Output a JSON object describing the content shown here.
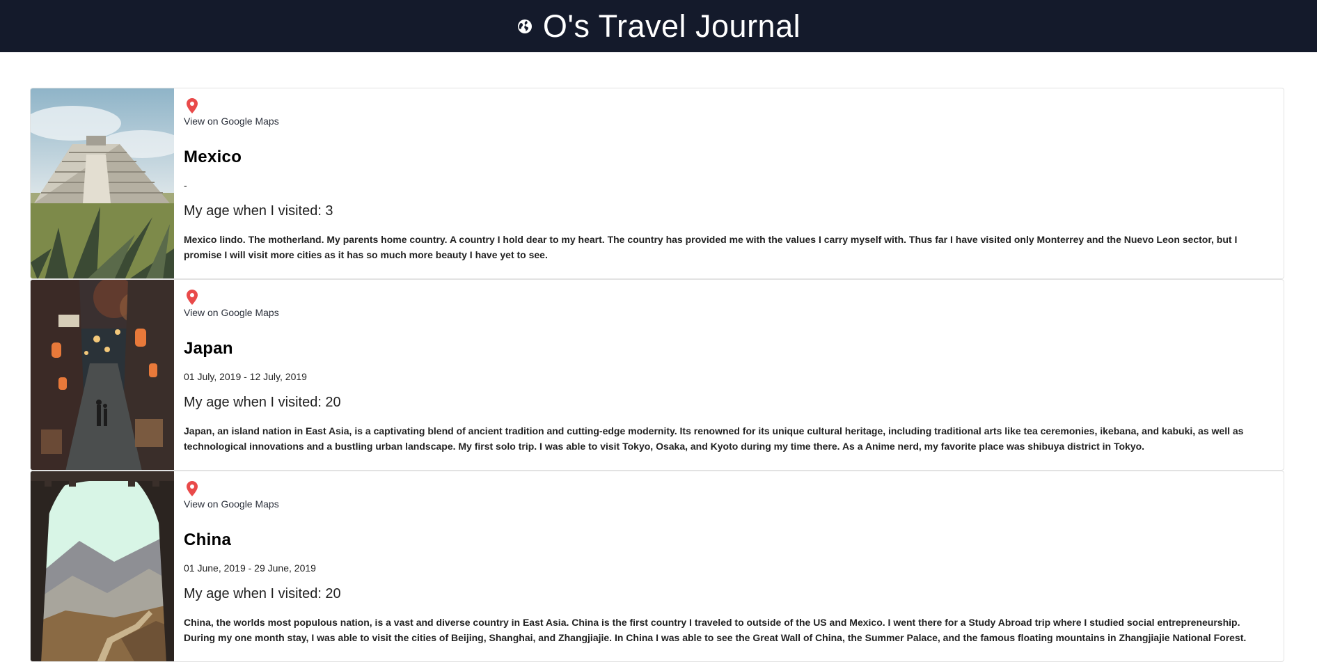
{
  "header": {
    "title": "O's Travel Journal",
    "icon": "globe-icon",
    "background": "#141a2b"
  },
  "entries": [
    {
      "image": "pyramid-photo",
      "pin_icon": "location-pin-icon",
      "maps_label": "View on Google Maps",
      "country": "Mexico",
      "dates": "-",
      "age": "My age when I visited: 3",
      "description": "Mexico lindo. The motherland. My parents home country. A country I hold dear to my heart. The country has provided me with the values I carry myself with. Thus far I have visited only Monterrey and the Nuevo Leon sector, but I promise I will visit more cities as it has so much more beauty I have yet to see."
    },
    {
      "image": "tokyo-alley-photo",
      "pin_icon": "location-pin-icon",
      "maps_label": "View on Google Maps",
      "country": "Japan",
      "dates": "01 July, 2019 - 12 July, 2019",
      "age": "My age when I visited: 20",
      "description": "Japan, an island nation in East Asia, is a captivating blend of ancient tradition and cutting-edge modernity. Its renowned for its unique cultural heritage, including traditional arts like tea ceremonies, ikebana, and kabuki, as well as technological innovations and a bustling urban landscape. My first solo trip. I was able to visit Tokyo, Osaka, and Kyoto during my time there. As a Anime nerd, my favorite place was shibuya district in Tokyo."
    },
    {
      "image": "great-wall-photo",
      "pin_icon": "location-pin-icon",
      "maps_label": "View on Google Maps",
      "country": "China",
      "dates": "01 June, 2019 - 29 June, 2019",
      "age": "My age when I visited: 20",
      "description": "China, the worlds most populous nation, is a vast and diverse country in East Asia. China is the first country I traveled to outside of the US and Mexico. I went there for a Study Abroad trip where I studied social entrepreneurship. During my one month stay, I was able to visit the cities of Beijing, Shanghai, and Zhangjiajie. In China I was able to see the Great Wall of China, the Summer Palace, and the famous floating mountains in Zhangjiajie National Forest."
    }
  ]
}
